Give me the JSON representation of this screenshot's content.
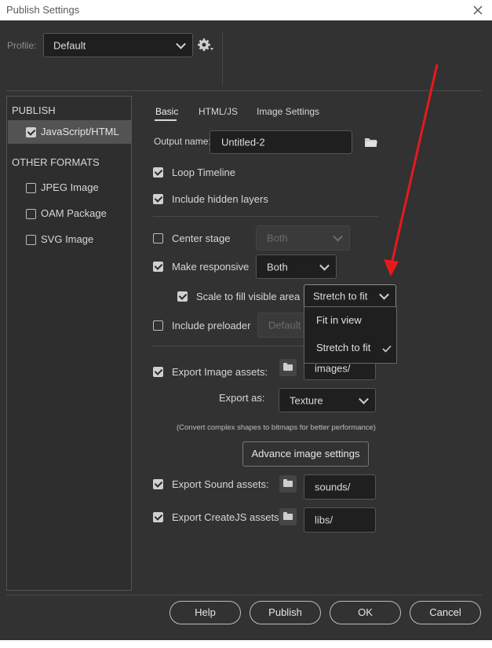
{
  "window": {
    "title": "Publish Settings"
  },
  "profile": {
    "label": "Profile:",
    "value": "Default"
  },
  "sidebar": {
    "publish_header": "PUBLISH",
    "other_header": "OTHER FORMATS",
    "items": [
      {
        "label": "JavaScript/HTML",
        "checked": true
      },
      {
        "label": "JPEG Image",
        "checked": false
      },
      {
        "label": "OAM Package",
        "checked": false
      },
      {
        "label": "SVG Image",
        "checked": false
      }
    ]
  },
  "tabs": [
    "Basic",
    "HTML/JS",
    "Image Settings"
  ],
  "basic": {
    "output_name_label": "Output name:",
    "output_name_value": "Untitled-2",
    "loop_timeline": {
      "label": "Loop Timeline",
      "checked": true
    },
    "include_hidden_layers": {
      "label": "Include hidden layers",
      "checked": true
    },
    "center_stage": {
      "label": "Center stage",
      "checked": false,
      "value": "Both"
    },
    "make_responsive": {
      "label": "Make responsive",
      "checked": true,
      "value": "Both"
    },
    "scale_to_fill": {
      "label": "Scale to fill visible area",
      "checked": true,
      "value": "Stretch to fit"
    },
    "scale_options": [
      "Fit in view",
      "Stretch to fit"
    ],
    "include_preloader": {
      "label": "Include preloader",
      "checked": false,
      "value": "Default"
    },
    "export_image_assets": {
      "label": "Export Image assets:",
      "checked": true,
      "path": "images/"
    },
    "export_as": {
      "label": "Export as:",
      "value": "Texture"
    },
    "note": "(Convert complex shapes to bitmaps for better performance)",
    "advance_image_settings": "Advance image settings",
    "export_sound_assets": {
      "label": "Export Sound assets:",
      "checked": true,
      "path": "sounds/"
    },
    "export_createjs_assets": {
      "label": "Export CreateJS assets:",
      "checked": true,
      "path": "libs/"
    }
  },
  "footer": {
    "help": "Help",
    "publish": "Publish",
    "ok": "OK",
    "cancel": "Cancel"
  },
  "colors": {
    "dialog_bg": "#323232",
    "annotation_arrow": "#e8191c"
  }
}
